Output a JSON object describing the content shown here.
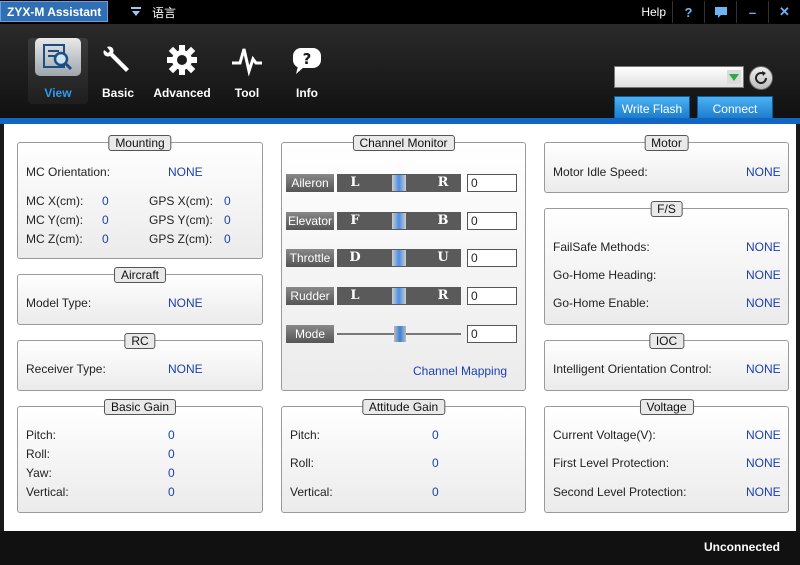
{
  "app": {
    "title": "ZYX-M Assistant",
    "language_label": "语言"
  },
  "titlebar": {
    "help_label": "Help",
    "help_icon": "question-icon",
    "min_icon": "minimize-icon",
    "close_icon": "close-icon"
  },
  "toolbar": {
    "tools": [
      {
        "label": "View",
        "icon": "magnifier-icon",
        "active": true
      },
      {
        "label": "Basic",
        "icon": "wrench-icon"
      },
      {
        "label": "Advanced",
        "icon": "gear-icon"
      },
      {
        "label": "Tool",
        "icon": "pulse-icon"
      },
      {
        "label": "Info",
        "icon": "info-speech-icon"
      }
    ],
    "port_select_value": "",
    "write_flash_label": "Write Flash",
    "connect_label": "Connect"
  },
  "panels": {
    "mounting": {
      "title": "Mounting",
      "orientation_label": "MC Orientation:",
      "orientation_value": "NONE",
      "mc_x_label": "MC X(cm):",
      "mc_x_value": "0",
      "mc_y_label": "MC Y(cm):",
      "mc_y_value": "0",
      "mc_z_label": "MC Z(cm):",
      "mc_z_value": "0",
      "gps_x_label": "GPS X(cm):",
      "gps_x_value": "0",
      "gps_y_label": "GPS Y(cm):",
      "gps_y_value": "0",
      "gps_z_label": "GPS Z(cm):",
      "gps_z_value": "0"
    },
    "aircraft": {
      "title": "Aircraft",
      "model_label": "Model Type:",
      "model_value": "NONE"
    },
    "rc": {
      "title": "RC",
      "receiver_label": "Receiver Type:",
      "receiver_value": "NONE"
    },
    "basic_gain": {
      "title": "Basic Gain",
      "pitch_label": "Pitch:",
      "pitch_value": "0",
      "roll_label": "Roll:",
      "roll_value": "0",
      "yaw_label": "Yaw:",
      "yaw_value": "0",
      "vertical_label": "Vertical:",
      "vertical_value": "0"
    },
    "channel_monitor": {
      "title": "Channel Monitor",
      "channels": [
        {
          "name": "Aileron",
          "left": "L",
          "right": "R",
          "value": "0"
        },
        {
          "name": "Elevator",
          "left": "F",
          "right": "B",
          "value": "0"
        },
        {
          "name": "Throttle",
          "left": "D",
          "right": "U",
          "value": "0"
        },
        {
          "name": "Rudder",
          "left": "L",
          "right": "R",
          "value": "0"
        }
      ],
      "mode_label": "Mode",
      "mode_value": "0",
      "mapping_link": "Channel Mapping"
    },
    "attitude_gain": {
      "title": "Attitude Gain",
      "pitch_label": "Pitch:",
      "pitch_value": "0",
      "roll_label": "Roll:",
      "roll_value": "0",
      "vertical_label": "Vertical:",
      "vertical_value": "0"
    },
    "motor": {
      "title": "Motor",
      "idle_label": "Motor Idle Speed:",
      "idle_value": "NONE"
    },
    "fs": {
      "title": "F/S",
      "methods_label": "FailSafe Methods:",
      "methods_value": "NONE",
      "heading_label": "Go-Home Heading:",
      "heading_value": "NONE",
      "enable_label": "Go-Home Enable:",
      "enable_value": "NONE"
    },
    "ioc": {
      "title": "IOC",
      "ioc_label": "Intelligent Orientation Control:",
      "ioc_value": "NONE"
    },
    "voltage": {
      "title": "Voltage",
      "current_label": "Current Voltage(V):",
      "current_value": "NONE",
      "first_label": "First Level Protection:",
      "first_value": "NONE",
      "second_label": "Second Level Protection:",
      "second_value": "NONE"
    }
  },
  "status": {
    "connection": "Unconnected"
  },
  "colors": {
    "accent": "#1166c4",
    "value_text": "#1a3fb3",
    "active_tab_text": "#2e9bf0"
  }
}
